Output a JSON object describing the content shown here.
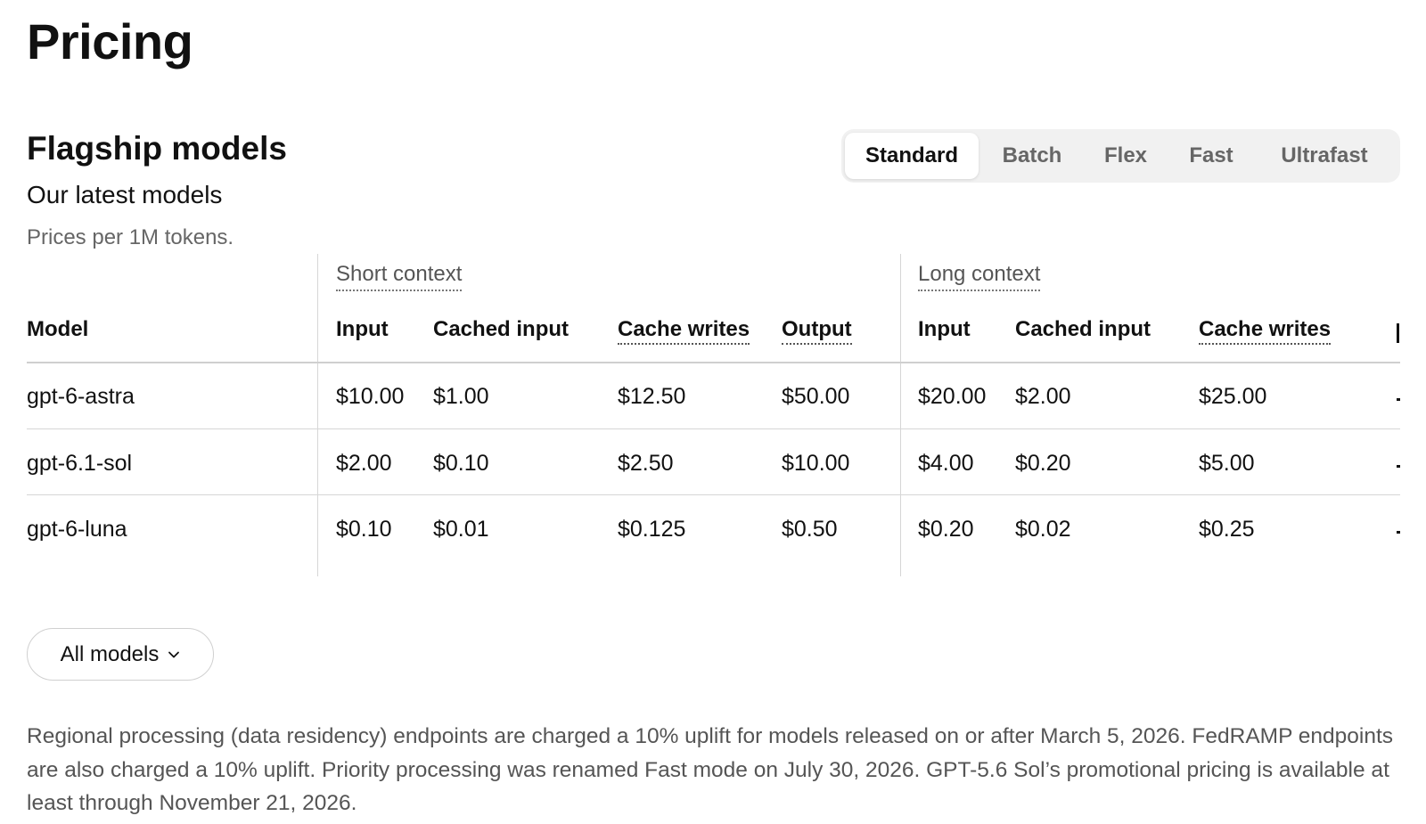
{
  "page": {
    "title": "Pricing"
  },
  "section": {
    "title": "Flagship models",
    "subtitle": "Our latest models",
    "price_note": "Prices per 1M tokens."
  },
  "tiers": {
    "items": [
      "Standard",
      "Batch",
      "Flex",
      "Fast",
      "Ultrafast"
    ],
    "selected": "Standard"
  },
  "table": {
    "groups": {
      "short": "Short context",
      "long": "Long context"
    },
    "headers": {
      "model": "Model",
      "short": [
        "Input",
        "Cached input",
        "Cache writes",
        "Output"
      ],
      "long": [
        "Input",
        "Cached input",
        "Cache writes"
      ]
    },
    "rows": [
      {
        "model": "gpt-6-astra",
        "short": [
          "$10.00",
          "$1.00",
          "$12.50",
          "$50.00"
        ],
        "long": [
          "$20.00",
          "$2.00",
          "$25.00"
        ]
      },
      {
        "model": "gpt-6.1-sol",
        "short": [
          "$2.00",
          "$0.10",
          "$2.50",
          "$10.00"
        ],
        "long": [
          "$4.00",
          "$0.20",
          "$5.00"
        ]
      },
      {
        "model": "gpt-6-luna",
        "short": [
          "$0.10",
          "$0.01",
          "$0.125",
          "$0.50"
        ],
        "long": [
          "$0.20",
          "$0.02",
          "$0.25"
        ]
      }
    ]
  },
  "models_dropdown": {
    "label": "All models",
    "icon": "chevron-down-icon"
  },
  "footnote": "Regional processing (data residency) endpoints are charged a 10% uplift for models released on or after March 5, 2026. FedRAMP endpoints are also charged a 10% uplift. Priority processing was renamed Fast mode on July 30, 2026. GPT-5.6 Sol’s promotional pricing is available at least through November 21, 2026."
}
